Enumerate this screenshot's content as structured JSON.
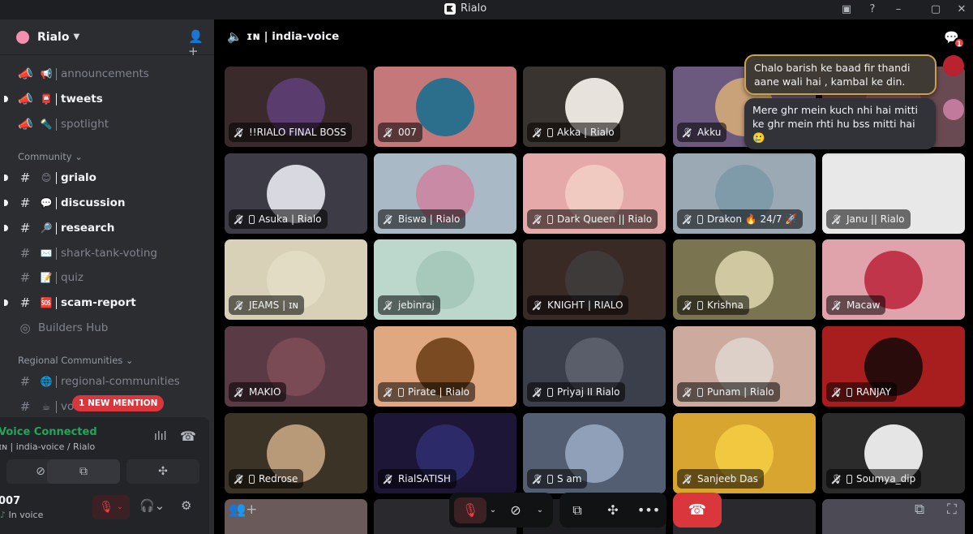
{
  "window": {
    "title": "Rialo"
  },
  "server": {
    "name": "Rialo"
  },
  "channels": [
    {
      "emoji": "📢",
      "name": "announcements",
      "bold": false,
      "unread": false,
      "icon": "megaphone-icon"
    },
    {
      "emoji": "📮",
      "name": "tweets",
      "bold": true,
      "unread": true,
      "icon": "megaphone-icon"
    },
    {
      "emoji": "🔦",
      "name": "spotlight",
      "bold": false,
      "unread": false,
      "icon": "megaphone-icon"
    },
    {
      "emoji": "😊",
      "name": "grialo",
      "bold": true,
      "unread": true,
      "icon": "hash-icon"
    },
    {
      "emoji": "💬",
      "name": "discussion",
      "bold": true,
      "unread": true,
      "icon": "hash-icon"
    },
    {
      "emoji": "🔎",
      "name": "research",
      "bold": true,
      "unread": true,
      "icon": "hash-icon"
    },
    {
      "emoji": "✉️",
      "name": "shark-tank-voting",
      "bold": false,
      "unread": false,
      "icon": "hash-icon"
    },
    {
      "emoji": "📝",
      "name": "quiz",
      "bold": false,
      "unread": false,
      "icon": "hash-icon"
    },
    {
      "emoji": "🆘",
      "name": "scam-report",
      "bold": true,
      "unread": true,
      "icon": "hash-icon"
    },
    {
      "emoji": "",
      "name": "Builders Hub",
      "bold": false,
      "unread": false,
      "icon": "forum-icon"
    },
    {
      "emoji": "🌐",
      "name": "regional-communities",
      "bold": false,
      "unread": false,
      "icon": "hash-icon"
    },
    {
      "emoji": "☕",
      "name": "vo",
      "bold": false,
      "unread": false,
      "icon": "hash-icon"
    }
  ],
  "categories": {
    "community": "Community",
    "regional": "Regional Communities"
  },
  "mention_pill": "1 NEW MENTION",
  "voice_panel": {
    "status": "Voice Connected",
    "channel": "ɪɴ | india-voice / Rialo",
    "username": "007",
    "user_status": "In voice"
  },
  "main_header": {
    "channel": "ɪɴ | india-voice"
  },
  "chat_badge": "1",
  "chat_messages": [
    "Chalo barish ke baad fir thandi aane wali hai , kambal ke din.",
    "Mere ghr mein kuch nhi hai mitti ke ghr mein rhti hu bss mitti hai 🥲"
  ],
  "participants": [
    {
      "name": "!!RIALO FINAL BOSS",
      "bg": "#3a2a2c",
      "av": "#5a3d6e",
      "phone": false
    },
    {
      "name": "007",
      "bg": "#c4787a",
      "av": "#2b6f8c",
      "phone": false
    },
    {
      "name": "Akka | Rialo",
      "bg": "#3a3430",
      "av": "#e8e2dc",
      "phone": true
    },
    {
      "name": "Akku",
      "bg": "#6b5a7e",
      "av": "#c9a27a",
      "phone": false
    },
    {
      "name": "",
      "bg": "#6a4a52",
      "av": "#8a5a6a",
      "phone": false
    },
    {
      "name": "Asuka | Rialo",
      "bg": "#3d3b45",
      "av": "#d8d8e0",
      "phone": true
    },
    {
      "name": "Biswa | Rialo",
      "bg": "#a9b9c6",
      "av": "#c98aa5",
      "phone": false
    },
    {
      "name": "Dark Queen || Rialo",
      "bg": "#e5a9a9",
      "av": "#f0c9c0",
      "phone": true
    },
    {
      "name": "Drakon 🔥 24/7 🚀",
      "bg": "#9aa9b3",
      "av": "#7f9aa8",
      "phone": true
    },
    {
      "name": "Janu || Rialo",
      "bg": "#e8e8e8",
      "av": "#e8e8e8",
      "phone": false
    },
    {
      "name": "JEAMS | ɪɴ",
      "bg": "#d8d1b8",
      "av": "#e2dcc4",
      "phone": false
    },
    {
      "name": "jebinraj",
      "bg": "#bcd8cc",
      "av": "#a7c9bc",
      "phone": false
    },
    {
      "name": "KNIGHT | RIALO",
      "bg": "#3a2a26",
      "av": "#3f3a3a",
      "phone": false
    },
    {
      "name": "Krishna",
      "bg": "#7a7450",
      "av": "#d0c8a0",
      "phone": true
    },
    {
      "name": "Macaw",
      "bg": "#e1a3ab",
      "av": "#c0354a",
      "phone": false
    },
    {
      "name": "MAKIO",
      "bg": "#5a3a45",
      "av": "#7a4a55",
      "phone": false
    },
    {
      "name": "Pirate | Rialo",
      "bg": "#e0a880",
      "av": "#7a4a22",
      "phone": true
    },
    {
      "name": "Priyaj II Rialo",
      "bg": "#3b3f4c",
      "av": "#5a5e6a",
      "phone": true
    },
    {
      "name": "Punam | Rialo",
      "bg": "#ccaa9e",
      "av": "#ddd0c8",
      "phone": true
    },
    {
      "name": "RANJAY",
      "bg": "#a81d1d",
      "av": "#2a0b0b",
      "phone": true
    },
    {
      "name": "Redrose",
      "bg": "#3b3426",
      "av": "#b89a78",
      "phone": true
    },
    {
      "name": "RialSATISH",
      "bg": "#1e1636",
      "av": "#2c2a68",
      "phone": false
    },
    {
      "name": "S am",
      "bg": "#545e72",
      "av": "#8fa0b8",
      "phone": true
    },
    {
      "name": "Sanjeeb Das",
      "bg": "#d9a531",
      "av": "#f2c840",
      "phone": false
    },
    {
      "name": "Soumya_dip",
      "bg": "#2b2b2b",
      "av": "#e5e5e5",
      "phone": true
    }
  ],
  "partial_row_bgs": [
    "#6b5a5a",
    "#2a2a2e",
    "#1e1e22",
    "#2a2a2e",
    "#4b4a55",
    "#2a2a30"
  ]
}
